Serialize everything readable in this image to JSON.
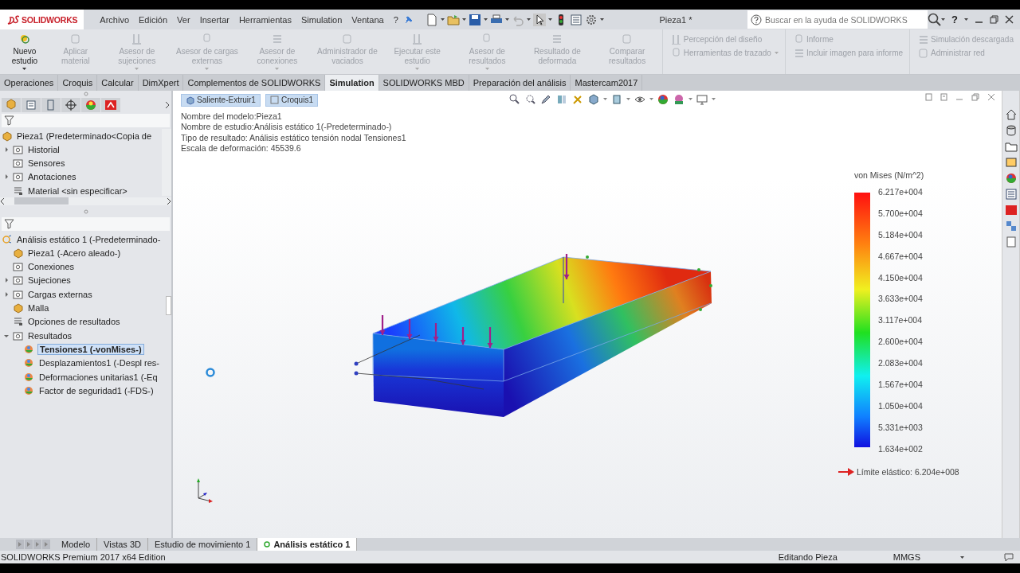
{
  "menubar": {
    "logo": "SOLIDWORKS",
    "menus": [
      "Archivo",
      "Edición",
      "Ver",
      "Insertar",
      "Herramientas",
      "Simulation",
      "Ventana",
      "?"
    ],
    "title": "Pieza1 *",
    "search": {
      "placeholder": "Buscar en la ayuda de SOLIDWORKS"
    },
    "help": "?"
  },
  "ribbon": [
    {
      "kind": "large",
      "label": "Nuevo estudio",
      "disabled": false,
      "dropdown": true
    },
    {
      "kind": "large",
      "label": "Aplicar material",
      "disabled": true,
      "dropdown": false
    },
    {
      "kind": "large",
      "label": "Asesor de sujeciones",
      "disabled": true,
      "dropdown": true
    },
    {
      "kind": "large",
      "label": "Asesor de cargas externas",
      "disabled": true,
      "dropdown": true
    },
    {
      "kind": "large",
      "label": "Asesor de conexiones",
      "disabled": true,
      "dropdown": true
    },
    {
      "kind": "large",
      "label": "Administrador de vaciados",
      "disabled": true,
      "dropdown": false
    },
    {
      "kind": "large",
      "label": "Ejecutar este estudio",
      "disabled": true,
      "dropdown": true
    },
    {
      "kind": "large",
      "label": "Asesor de resultados",
      "disabled": true,
      "dropdown": true
    },
    {
      "kind": "large",
      "label": "Resultado de deformada",
      "disabled": true,
      "dropdown": false
    },
    {
      "kind": "large",
      "label": "Comparar resultados",
      "disabled": true,
      "dropdown": false
    },
    {
      "kind": "stack",
      "items": [
        {
          "label": "Percepción del diseño",
          "disabled": true,
          "dropdown": false
        },
        {
          "label": "Herramientas de trazado",
          "disabled": true,
          "dropdown": true
        }
      ]
    },
    {
      "kind": "stack",
      "items": [
        {
          "label": "Informe",
          "disabled": true,
          "dropdown": false
        },
        {
          "label": "Incluir imagen para informe",
          "disabled": true,
          "dropdown": false
        }
      ]
    },
    {
      "kind": "stack",
      "items": [
        {
          "label": "Simulación descargada",
          "disabled": true,
          "dropdown": false
        },
        {
          "label": "Administrar red",
          "disabled": true,
          "dropdown": false
        }
      ]
    }
  ],
  "tabs": [
    {
      "label": "Operaciones",
      "selected": false
    },
    {
      "label": "Croquis",
      "selected": false
    },
    {
      "label": "Calcular",
      "selected": false
    },
    {
      "label": "DimXpert",
      "selected": false
    },
    {
      "label": "Complementos de SOLIDWORKS",
      "selected": false
    },
    {
      "label": "Simulation",
      "selected": true
    },
    {
      "label": "SOLIDWORKS MBD",
      "selected": false
    },
    {
      "label": "Preparación del análisis",
      "selected": false
    },
    {
      "label": "Mastercam2017",
      "selected": false
    }
  ],
  "feature_tree": {
    "root": "Pieza1  (Predeterminado<Copia de",
    "items": [
      {
        "label": "Historial",
        "expanded": false
      },
      {
        "label": "Sensores"
      },
      {
        "label": "Anotaciones",
        "expanded": false
      },
      {
        "label": "Material <sin especificar>"
      }
    ]
  },
  "study_tree": {
    "root": "Análisis estático 1 (-Predeterminado-",
    "items": [
      {
        "label": "Pieza1 (-Acero aleado-)"
      },
      {
        "label": "Conexiones"
      },
      {
        "label": "Sujeciones",
        "expanded": false
      },
      {
        "label": "Cargas externas",
        "expanded": false
      },
      {
        "label": "Malla"
      },
      {
        "label": "Opciones de resultados"
      },
      {
        "label": "Resultados",
        "expanded": true,
        "children": [
          {
            "label": "Tensiones1 (-vonMises-)",
            "selected": true
          },
          {
            "label": "Desplazamientos1 (-Despl res-",
            "selected": false
          },
          {
            "label": "Deformaciones unitarias1 (-Eq",
            "selected": false
          },
          {
            "label": "Factor de seguridad1 (-FDS-)",
            "selected": false
          }
        ]
      }
    ]
  },
  "viewport": {
    "breadcrumb": [
      "Saliente-Extruir1",
      "Croquis1"
    ],
    "info": [
      "Nombre del modelo:Pieza1",
      "Nombre de estudio:Análisis estático 1(-Predeterminado-)",
      "Tipo de resultado: Análisis estático tensión nodal Tensiones1",
      "Escala de deformación: 45539.6"
    ],
    "legend": {
      "title": "von Mises (N/m^2)",
      "ticks": [
        "6.217e+004",
        "5.700e+004",
        "5.184e+004",
        "4.667e+004",
        "4.150e+004",
        "3.633e+004",
        "3.117e+004",
        "2.600e+004",
        "2.083e+004",
        "1.567e+004",
        "1.050e+004",
        "5.331e+003",
        "1.634e+002"
      ],
      "yield": "Límite elástico: 6.204e+008"
    }
  },
  "bottom_tabs": [
    {
      "label": "Modelo",
      "selected": false
    },
    {
      "label": "Vistas 3D",
      "selected": false
    },
    {
      "label": "Estudio de movimiento 1",
      "selected": false
    },
    {
      "label": "Análisis estático 1",
      "selected": true
    }
  ],
  "status_bar": {
    "edition": "SOLIDWORKS Premium 2017 x64 Edition",
    "mode": "Editando Pieza",
    "units": "MMGS"
  }
}
